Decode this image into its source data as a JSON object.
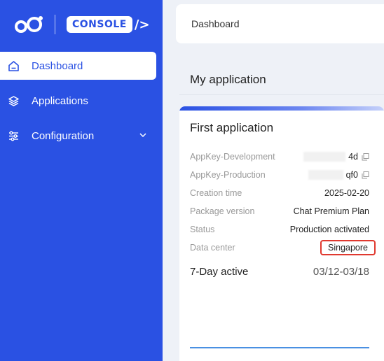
{
  "brand": {
    "console_word": "CONSOLE",
    "console_slash": "/>"
  },
  "sidebar": {
    "items": [
      {
        "label": "Dashboard",
        "icon": "home-icon",
        "active": true
      },
      {
        "label": "Applications",
        "icon": "layers-icon",
        "active": false
      },
      {
        "label": "Configuration",
        "icon": "sliders-icon",
        "active": false,
        "expandable": true
      }
    ]
  },
  "header": {
    "breadcrumb": "Dashboard"
  },
  "main": {
    "section_title": "My application",
    "app_card": {
      "title": "First application",
      "rows": [
        {
          "label": "AppKey-Development",
          "value": "4d",
          "copyable": true,
          "masked": true
        },
        {
          "label": "AppKey-Production",
          "value": "qf0",
          "copyable": true,
          "masked": true
        },
        {
          "label": "Creation time",
          "value": "2025-02-20"
        },
        {
          "label": "Package version",
          "value": "Chat Premium Plan"
        },
        {
          "label": "Status",
          "value": "Production activated"
        },
        {
          "label": "Data center",
          "value": "Singapore",
          "highlighted": true
        }
      ],
      "active": {
        "title": "7-Day active",
        "range": "03/12-03/18"
      }
    }
  },
  "colors": {
    "sidebar": "#2a51e3",
    "accent": "#2a51e3",
    "highlight": "#e0392f",
    "chart_line": "#4a90e2"
  }
}
